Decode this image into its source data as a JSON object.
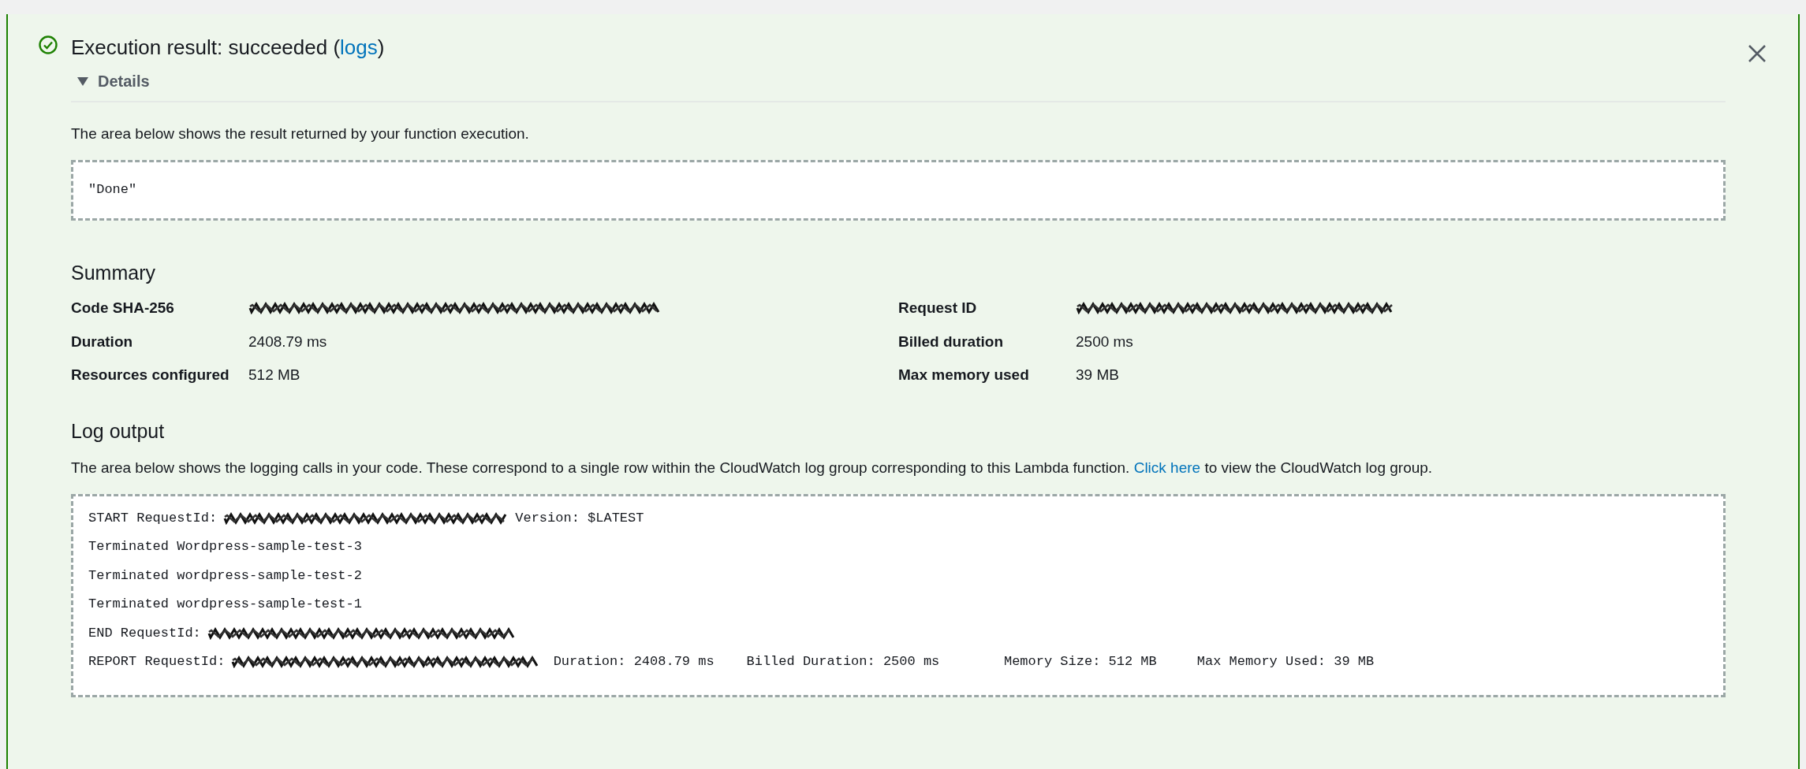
{
  "alert": {
    "kind": "success",
    "title": "Execution result: succeeded (",
    "link": "logs",
    "title_end": ")"
  },
  "details": {
    "label": "Details",
    "expanded": true
  },
  "result": {
    "description": "The area below shows the result returned by your function execution.",
    "value": "\"Done\""
  },
  "summary": {
    "heading": "Summary",
    "rows": [
      {
        "label": "Code SHA-256",
        "kind": "redacted"
      },
      {
        "label": "Request ID",
        "kind": "redacted"
      },
      {
        "label": "Duration",
        "kind": "text",
        "value": "2408.79 ms"
      },
      {
        "label": "Billed duration",
        "kind": "text",
        "value": "2500 ms"
      },
      {
        "label": "Resources configured",
        "kind": "text",
        "value": "512 MB"
      },
      {
        "label": "Max memory used",
        "kind": "text",
        "value": "39 MB"
      }
    ]
  },
  "log": {
    "heading": "Log output",
    "description": "The area below shows the logging calls in your code. These correspond to a single row within the CloudWatch log group corresponding to this Lambda function.",
    "link": "Click here",
    "description_end": "to view the CloudWatch log group.",
    "lines": [
      [
        {
          "kind": "text",
          "text": "START RequestId:"
        },
        {
          "kind": "redacted"
        },
        {
          "kind": "text",
          "text": "Version: $LATEST"
        }
      ],
      [
        {
          "kind": "text",
          "text": "Terminated Wordpress-sample-test-3"
        }
      ],
      [
        {
          "kind": "text",
          "text": "Terminated wordpress-sample-test-2"
        }
      ],
      [
        {
          "kind": "text",
          "text": "Terminated wordpress-sample-test-1"
        }
      ],
      [
        {
          "kind": "text",
          "text": "END RequestId:"
        },
        {
          "kind": "redacted"
        }
      ],
      [
        {
          "kind": "text",
          "text": "REPORT RequestId:"
        },
        {
          "kind": "redacted"
        },
        {
          "kind": "text",
          "text": " Duration: 2408.79 ms    Billed Duration: 2500 ms        Memory Size: 512 MB     Max Memory Used: 39 MB"
        }
      ]
    ]
  }
}
